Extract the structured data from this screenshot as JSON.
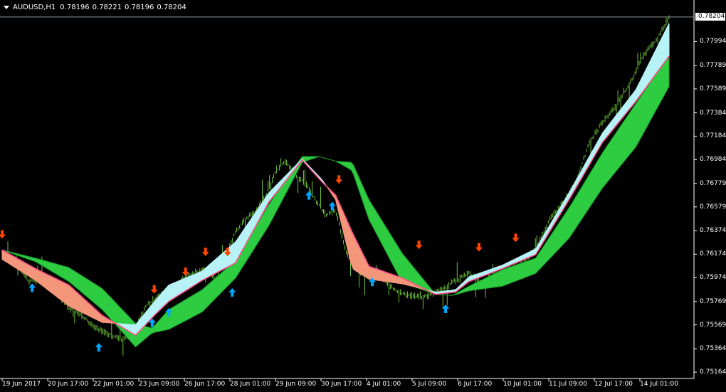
{
  "chart_window": {
    "symbol": "AUDUSD,H1",
    "open": "0.78196",
    "high": "0.78221",
    "low": "0.78196",
    "close": "0.78204",
    "current_price": "0.78204",
    "menu_icon": "triangle-down-icon"
  },
  "colors": {
    "background": "#000000",
    "foreground": "#ffffff",
    "bar_color": "#6ec33a",
    "bull_cloud": "#2ecc40",
    "bull_cloud_edge": "#1a9a2a",
    "bear_cloud": "#c4187f",
    "bear_cloud_edge": "#2e8a2e",
    "fast_bull_fill": "#b6f2f6",
    "fast_bear_fill": "#f4967a",
    "fast_ma_line": "#ff4d8a",
    "buy_arrow": "#00a8ff",
    "sell_arrow": "#ff4400",
    "price_line": "#8c9aa6"
  },
  "chart_data": {
    "type": "candlestick-bars",
    "title": "AUDUSD,H1",
    "timeframe": "H1",
    "y_ticks": [
      "0.78204",
      "0.77994",
      "0.77789",
      "0.77589",
      "0.77384",
      "0.77184",
      "0.76984",
      "0.76779",
      "0.76579",
      "0.76374",
      "0.76174",
      "0.75974",
      "0.75769",
      "0.75569",
      "0.75364",
      "0.75164"
    ],
    "ylim": [
      0.7511,
      0.7824
    ],
    "x_ticks": [
      "19 Jun 2017",
      "20 Jun 17:00",
      "22 Jun 01:00",
      "23 Jun 09:00",
      "26 Jun 17:00",
      "28 Jun 01:00",
      "29 Jun 09:00",
      "30 Jun 17:00",
      "4 Jul 01:00",
      "5 Jul 09:00",
      "6 Jul 17:00",
      "10 Jul 01:00",
      "11 Jul 09:00",
      "12 Jul 17:00",
      "14 Jul 01:00"
    ],
    "close_path": {
      "t": [
        0,
        0.02,
        0.04,
        0.06,
        0.08,
        0.1,
        0.12,
        0.14,
        0.16,
        0.18,
        0.2,
        0.215,
        0.23,
        0.245,
        0.26,
        0.275,
        0.29,
        0.305,
        0.32,
        0.335,
        0.35,
        0.365,
        0.38,
        0.395,
        0.41,
        0.425,
        0.44,
        0.455,
        0.47,
        0.485,
        0.5,
        0.515,
        0.53,
        0.545,
        0.56,
        0.575,
        0.59,
        0.605,
        0.62,
        0.64,
        0.66,
        0.68,
        0.7,
        0.72,
        0.74,
        0.76,
        0.78,
        0.8,
        0.82,
        0.84,
        0.86,
        0.88,
        0.9,
        0.92,
        0.94,
        0.96,
        0.98,
        1
      ],
      "close": [
        0.7618,
        0.7611,
        0.7594,
        0.7599,
        0.7586,
        0.7571,
        0.7565,
        0.7554,
        0.7549,
        0.7544,
        0.7554,
        0.7573,
        0.7579,
        0.7585,
        0.7591,
        0.7598,
        0.7602,
        0.7604,
        0.7596,
        0.7614,
        0.7637,
        0.7648,
        0.7654,
        0.7667,
        0.7688,
        0.7697,
        0.7684,
        0.7678,
        0.7664,
        0.7651,
        0.7655,
        0.7621,
        0.7605,
        0.7599,
        0.7605,
        0.7594,
        0.7586,
        0.7583,
        0.7581,
        0.7582,
        0.7587,
        0.7595,
        0.7601,
        0.7593,
        0.7601,
        0.7604,
        0.761,
        0.7622,
        0.7646,
        0.7661,
        0.7678,
        0.7712,
        0.773,
        0.7744,
        0.7762,
        0.7786,
        0.78,
        0.782
      ]
    },
    "slow_cloud": {
      "t": [
        0,
        0.05,
        0.1,
        0.15,
        0.2,
        0.225,
        0.25,
        0.3,
        0.35,
        0.4,
        0.45,
        0.475,
        0.5,
        0.525,
        0.55,
        0.6,
        0.65,
        0.675,
        0.7,
        0.75,
        0.8,
        0.85,
        0.9,
        0.95,
        1
      ],
      "upper": [
        0.7621,
        0.7614,
        0.7606,
        0.7588,
        0.7558,
        0.7554,
        0.757,
        0.7587,
        0.7612,
        0.766,
        0.7701,
        0.7701,
        0.7697,
        0.7696,
        0.7664,
        0.7618,
        0.7583,
        0.7582,
        0.759,
        0.7604,
        0.7614,
        0.7657,
        0.7704,
        0.7746,
        0.7788
      ],
      "lower": [
        0.7621,
        0.7611,
        0.7594,
        0.757,
        0.7538,
        0.755,
        0.7553,
        0.7568,
        0.7597,
        0.7642,
        0.7696,
        0.7701,
        0.7697,
        0.7689,
        0.7647,
        0.7593,
        0.7583,
        0.7582,
        0.7586,
        0.759,
        0.7601,
        0.7631,
        0.7674,
        0.7709,
        0.7761
      ]
    },
    "fast_cloud": {
      "t": [
        0,
        0.05,
        0.1,
        0.15,
        0.2,
        0.23,
        0.25,
        0.3,
        0.35,
        0.4,
        0.45,
        0.48,
        0.5,
        0.525,
        0.55,
        0.6,
        0.65,
        0.68,
        0.7,
        0.75,
        0.8,
        0.85,
        0.9,
        0.95,
        1
      ],
      "ma": [
        0.7621,
        0.7605,
        0.7591,
        0.7565,
        0.7548,
        0.7566,
        0.7577,
        0.7595,
        0.761,
        0.7662,
        0.7698,
        0.7679,
        0.7668,
        0.7636,
        0.7607,
        0.7597,
        0.7583,
        0.7585,
        0.7594,
        0.7605,
        0.7617,
        0.7664,
        0.7713,
        0.7748,
        0.7787
      ],
      "price": [
        0.7613,
        0.7595,
        0.7573,
        0.7559,
        0.7557,
        0.7578,
        0.7591,
        0.7603,
        0.7628,
        0.767,
        0.7699,
        0.7681,
        0.7664,
        0.7605,
        0.7596,
        0.7592,
        0.7585,
        0.7587,
        0.7598,
        0.7608,
        0.7622,
        0.767,
        0.7721,
        0.7758,
        0.7815
      ]
    },
    "buy_arrows": {
      "t": [
        0.045,
        0.145,
        0.225,
        0.25,
        0.345,
        0.46,
        0.495,
        0.555,
        0.665
      ],
      "price": [
        0.7596,
        0.7545,
        0.7566,
        0.7575,
        0.7592,
        0.7675,
        0.7666,
        0.7601,
        0.7578
      ]
    },
    "sell_arrows": {
      "t": [
        0.0,
        0.228,
        0.275,
        0.305,
        0.338,
        0.505,
        0.625,
        0.715,
        0.77
      ],
      "price": [
        0.7627,
        0.758,
        0.7595,
        0.7612,
        0.7612,
        0.7674,
        0.7618,
        0.7616,
        0.7624
      ]
    }
  }
}
